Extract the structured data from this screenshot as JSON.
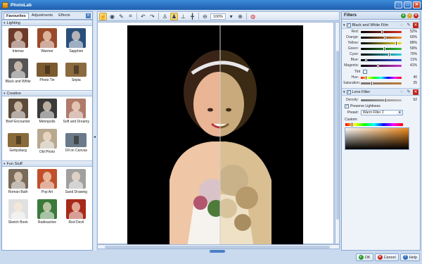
{
  "window": {
    "title": "PhotoLab"
  },
  "left_panel": {
    "tabs": [
      {
        "label": "Favourites",
        "active": true
      },
      {
        "label": "Adjustments",
        "active": false
      },
      {
        "label": "Effects",
        "active": false
      }
    ],
    "sections": [
      {
        "title": "Lighting",
        "items": [
          {
            "label": "Intense",
            "thumb": "#6d3b2a"
          },
          {
            "label": "Warmer",
            "thumb": "#9a4a2a"
          },
          {
            "label": "Sapphire",
            "thumb": "#2a4f7a"
          },
          {
            "label": "Black and White",
            "thumb": "#555555"
          },
          {
            "label": "Photo Tin",
            "thumb": "#7a5a2e"
          },
          {
            "label": "Sepia",
            "thumb": "#8a6a3e"
          }
        ]
      },
      {
        "title": "Creative",
        "items": [
          {
            "label": "Brief Encounter",
            "thumb": "#5c4a3a"
          },
          {
            "label": "Metropolis",
            "thumb": "#3a3a3a"
          },
          {
            "label": "Soft and Dreamy",
            "thumb": "#b07a6a"
          },
          {
            "label": "Gettysburg",
            "thumb": "#8a6a3a"
          },
          {
            "label": "Old Photo",
            "thumb": "#b8a890"
          },
          {
            "label": "Oil on Canvas",
            "thumb": "#6a7a8a"
          }
        ]
      },
      {
        "title": "Fun Stuff",
        "items": [
          {
            "label": "Roman Bath",
            "thumb": "#7a6a5a"
          },
          {
            "label": "Pop Art",
            "thumb": "#c0502a"
          },
          {
            "label": "Sand Drawing",
            "thumb": "#a0a0a0"
          },
          {
            "label": "Sketch Book",
            "thumb": "#e0e0e0"
          },
          {
            "label": "Radioactive",
            "thumb": "#3a7a3a"
          },
          {
            "label": "Red Devil",
            "thumb": "#a82a1a"
          }
        ]
      }
    ]
  },
  "toolbar": {
    "buttons": [
      "pointer-icon",
      "eye-icon",
      "brush-icon",
      "crop-icon",
      "undo-icon",
      "redo-icon",
      "person-icon",
      "person-compare-icon",
      "split-view-icon",
      "compare-icon",
      "zoom-out-icon"
    ],
    "zoom_label": "100%",
    "zoom_in_icon": "zoom-in-icon",
    "color_icon": "color-wheel-icon"
  },
  "right_panel": {
    "title": "Filters",
    "bw_filter": {
      "name": "Black and White Film",
      "sliders": [
        {
          "label": "Red:",
          "value": "52%",
          "fraction": 0.52,
          "track": "linear-gradient(to right,#000,#e03020)"
        },
        {
          "label": "Orange:",
          "value": "60%",
          "fraction": 0.6,
          "track": "linear-gradient(to right,#000,#f09030)"
        },
        {
          "label": "Yellow:",
          "value": "89%",
          "fraction": 0.89,
          "track": "linear-gradient(to right,#000,#f0e030)"
        },
        {
          "label": "Green:",
          "value": "59%",
          "fraction": 0.59,
          "track": "linear-gradient(to right,#000,#30c030)"
        },
        {
          "label": "Cyan:",
          "value": "70%",
          "fraction": 0.7,
          "track": "linear-gradient(to right,#000,#30d0e0)"
        },
        {
          "label": "Blue:",
          "value": "11%",
          "fraction": 0.11,
          "track": "linear-gradient(to right,#000,#3050e0)"
        },
        {
          "label": "Magenta:",
          "value": "41%",
          "fraction": 0.41,
          "track": "linear-gradient(to right,#000,#d030d0)"
        }
      ],
      "tint_label": "Tint",
      "tint_sliders": [
        {
          "label": "Hue:",
          "value": "40",
          "fraction": 0.11,
          "track": "linear-gradient(to right,#f00,#ff0,#0f0,#0ff,#00f,#f0f,#f00)"
        },
        {
          "label": "Saturation:",
          "value": "25",
          "fraction": 0.25,
          "track": "linear-gradient(to right,#777,#c07a30)"
        }
      ]
    },
    "lens_filter": {
      "name": "Lens Filter",
      "density_label": "Density:",
      "density_value": "62",
      "density_fraction": 0.62,
      "preserve_label": "Preserve Lightness",
      "preset_label": "Preset:",
      "preset_value": "Warm Filter 2",
      "custom_label": "Custom:"
    }
  },
  "dialog_buttons": {
    "ok": "OK",
    "cancel": "Cancel",
    "help": "Help"
  }
}
